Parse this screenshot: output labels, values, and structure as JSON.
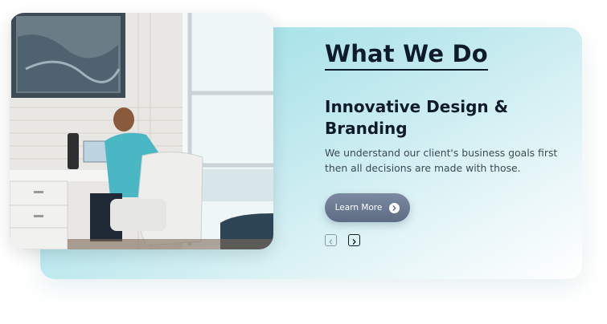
{
  "section": {
    "heading": "What We Do",
    "subheading": "Innovative Design & Branding",
    "description": "We understand our client's business goals first then all decisions are made with those."
  },
  "cta": {
    "label": "Learn More",
    "icon": "arrow-right-circle-icon"
  },
  "carousel": {
    "prev_icon": "chevron-left-icon",
    "next_icon": "chevron-right-icon"
  },
  "colors": {
    "heading": "#0d1b2a",
    "button": "#6b7a91",
    "card_gradient_start": "#8fdce4"
  }
}
